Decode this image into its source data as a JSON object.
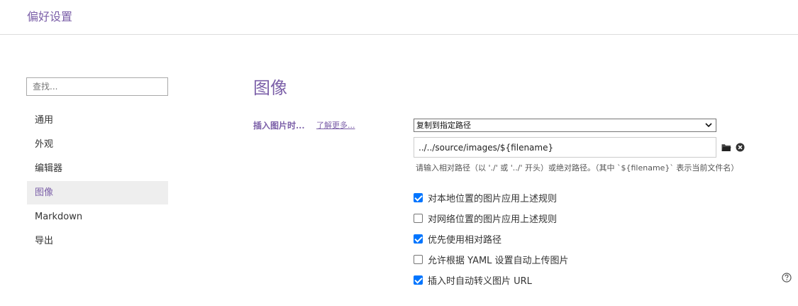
{
  "window": {
    "title": "偏好设置"
  },
  "sidebar": {
    "search_placeholder": "查找...",
    "items": [
      {
        "label": "通用",
        "active": false
      },
      {
        "label": "外观",
        "active": false
      },
      {
        "label": "编辑器",
        "active": false
      },
      {
        "label": "图像",
        "active": true
      },
      {
        "label": "Markdown",
        "active": false
      },
      {
        "label": "导出",
        "active": false
      }
    ]
  },
  "main": {
    "section_title": "图像",
    "insert_image": {
      "label": "插入图片时...",
      "learn_more": "了解更多...",
      "action_selected": "复制到指定路径",
      "path_value": "../../source/images/${filename}",
      "hint": "请输入相对路径（以 './' 或 '../' 开头）或绝对路径。（其中 `${filename}` 表示当前文件名）"
    },
    "options": [
      {
        "label": "对本地位置的图片应用上述规则",
        "checked": true
      },
      {
        "label": "对网络位置的图片应用上述规则",
        "checked": false
      },
      {
        "label": "优先使用相对路径",
        "checked": true
      },
      {
        "label": "允许根据 YAML 设置自动上传图片",
        "checked": false
      },
      {
        "label": "插入时自动转义图片 URL",
        "checked": true
      }
    ]
  },
  "icons": {
    "folder": "folder-icon",
    "clear": "clear-icon",
    "chevron": "chevron-down-icon",
    "help": "help-icon"
  },
  "colors": {
    "accent": "#7b5fa8",
    "checkbox": "#0075ff",
    "active_nav_bg": "#eeeeee"
  }
}
